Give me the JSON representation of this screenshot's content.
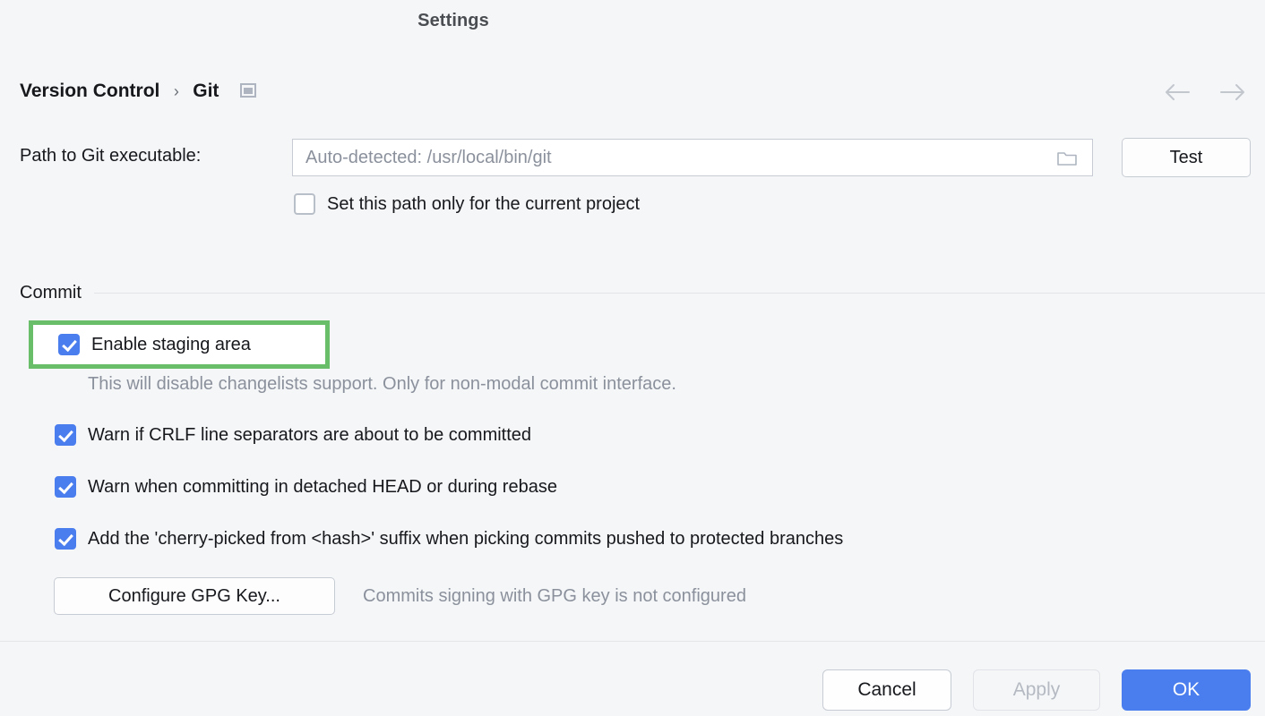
{
  "window": {
    "title": "Settings"
  },
  "breadcrumb": {
    "parent": "Version Control",
    "separator": "›",
    "current": "Git",
    "panel_icon": "panel-icon"
  },
  "nav": {
    "back_icon": "arrow-left-icon",
    "forward_icon": "arrow-right-icon"
  },
  "path_section": {
    "label": "Path to Git executable:",
    "input_value": "",
    "input_placeholder": "Auto-detected: /usr/local/bin/git",
    "browse_icon": "folder-icon",
    "test_button": "Test",
    "project_scope_checkbox": {
      "label": "Set this path only for the current project",
      "checked": false
    }
  },
  "commit_section": {
    "title": "Commit",
    "staging": {
      "label": "Enable staging area",
      "checked": true,
      "highlighted": true,
      "highlight_color": "#69bf69",
      "hint": "This will disable changelists support. Only for non-modal commit interface."
    },
    "options": [
      {
        "label": "Warn if CRLF line separators are about to be committed",
        "checked": true
      },
      {
        "label": "Warn when committing in detached HEAD or during rebase",
        "checked": true
      },
      {
        "label": "Add the 'cherry-picked from <hash>' suffix when picking commits pushed to protected branches",
        "checked": true
      }
    ],
    "gpg": {
      "button_label": "Configure GPG Key...",
      "status": "Commits signing with GPG key is not configured"
    }
  },
  "footer": {
    "cancel": "Cancel",
    "apply": "Apply",
    "apply_disabled": true,
    "ok": "OK",
    "accent_color": "#4a7dee"
  }
}
